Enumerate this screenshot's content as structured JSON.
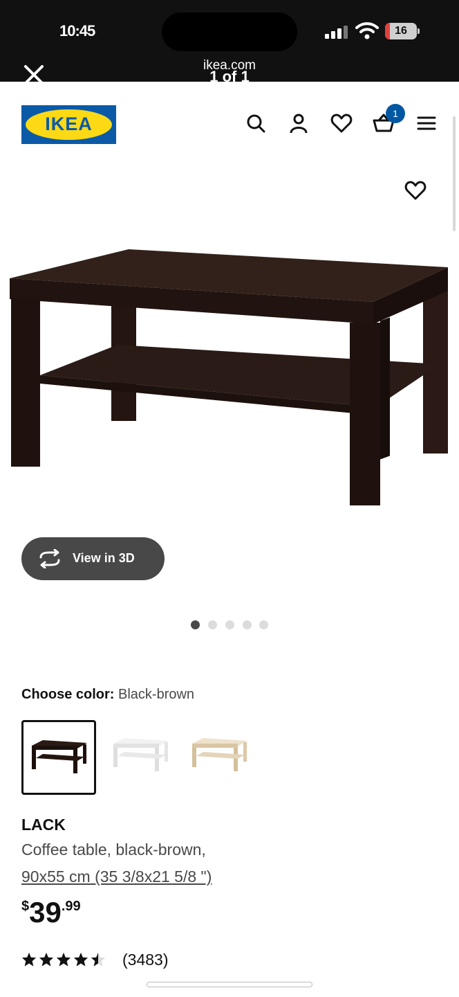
{
  "status_bar": {
    "time": "10:45",
    "battery_percent": 16,
    "battery_text": "16"
  },
  "browser": {
    "url": "ikea.com",
    "page_counter": "1 of 1",
    "close_icon": "close-icon"
  },
  "header": {
    "logo_text": "IKEA",
    "cart_count": "1",
    "icons": [
      "search-icon",
      "profile-icon",
      "heart-icon",
      "cart-icon",
      "menu-icon"
    ]
  },
  "gallery": {
    "view3d_label": "View in 3D",
    "total_images": 5,
    "active_image": 1
  },
  "colors": {
    "label": "Choose color:",
    "selected": "Black-brown",
    "options": [
      "Black-brown",
      "White",
      "White stained oak effect"
    ],
    "selected_index": 0
  },
  "product": {
    "name": "LACK",
    "description": "Coffee table, black-brown,",
    "size": "90x55 cm (35 3/8x21 5/8 \")",
    "price_currency": "$",
    "price_integer": "39",
    "price_decimal": ".99",
    "rating": 4.5,
    "review_count": "(3483)"
  },
  "theme": {
    "ikea_blue": "#0058a3",
    "ikea_yellow": "#fbd914",
    "text_dark": "#111111",
    "text_muted": "#484848",
    "battery_low": "#e0413b"
  }
}
